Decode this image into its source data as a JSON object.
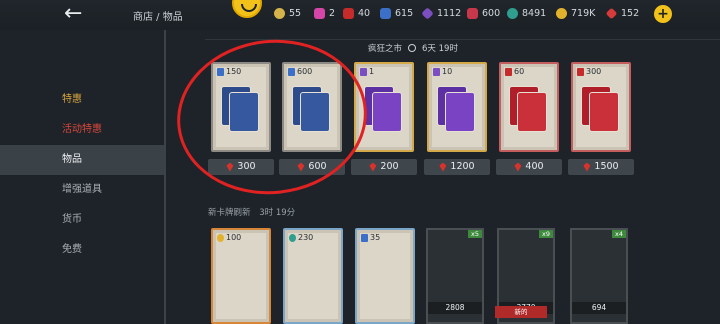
{
  "header": {
    "breadcrumb": "商店 / 物品",
    "currencies": [
      {
        "value": "55",
        "color": "#d6b34a",
        "icon": "coin-icon"
      },
      {
        "value": "2",
        "color": "#d645a8",
        "icon": "ticket-icon"
      },
      {
        "value": "40",
        "color": "#c62b2b",
        "icon": "shard-icon"
      },
      {
        "value": "615",
        "color": "#3b6fc8",
        "icon": "card-icon"
      },
      {
        "value": "1112",
        "color": "#7b4fc2",
        "icon": "crystal-icon"
      },
      {
        "value": "600",
        "color": "#c9384a",
        "icon": "ruby-icon"
      },
      {
        "value": "8491",
        "color": "#2f9e8f",
        "icon": "token-icon"
      },
      {
        "value": "719K",
        "color": "#e2b22d",
        "icon": "gold-icon"
      },
      {
        "value": "152",
        "color": "#d63b3b",
        "icon": "gem-icon"
      }
    ]
  },
  "sidebar": {
    "items": [
      {
        "label": "特惠",
        "style": "gold"
      },
      {
        "label": "活动特惠",
        "style": "red"
      },
      {
        "label": "物品",
        "style": "active"
      },
      {
        "label": "增强道具",
        "style": ""
      },
      {
        "label": "货币",
        "style": ""
      },
      {
        "label": "免费",
        "style": ""
      }
    ]
  },
  "market": {
    "title": "疯狂之市",
    "timer": "6天 19时",
    "cards": [
      {
        "qty": "150",
        "price": "300",
        "variant": "blue"
      },
      {
        "qty": "600",
        "price": "600",
        "variant": "blue"
      },
      {
        "qty": "1",
        "price": "200",
        "variant": "purple"
      },
      {
        "qty": "10",
        "price": "1200",
        "variant": "purple"
      },
      {
        "qty": "60",
        "price": "400",
        "variant": "red"
      },
      {
        "qty": "300",
        "price": "1500",
        "variant": "red"
      }
    ]
  },
  "row2": {
    "header": "新卡牌刷新",
    "timer": "3时 19分",
    "items": [
      {
        "qty": "100",
        "variant": "orange"
      },
      {
        "qty": "230",
        "variant": "lightblue"
      },
      {
        "qty": "35",
        "variant": "lightblue"
      },
      {
        "count": "x5",
        "price": "2808"
      },
      {
        "count": "x9",
        "price": "3770",
        "tag": "新的"
      },
      {
        "count": "x4",
        "price": "694"
      }
    ]
  }
}
